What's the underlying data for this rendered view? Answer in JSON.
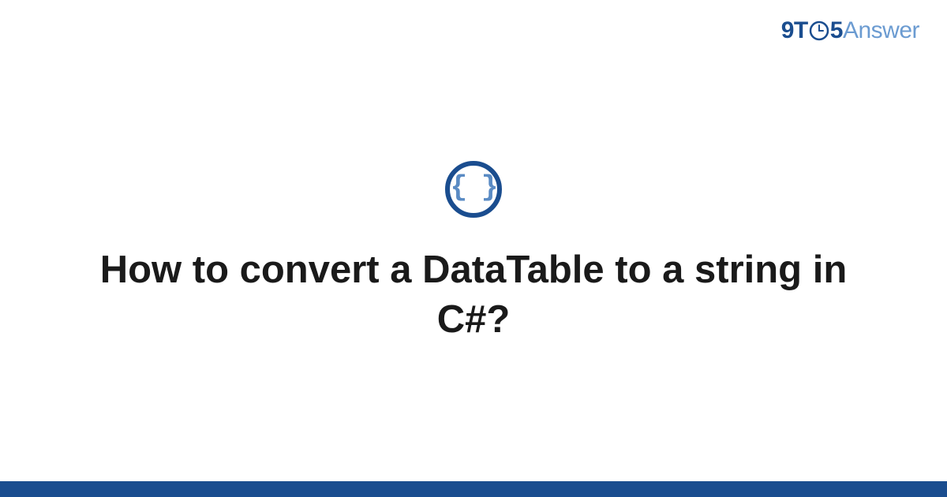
{
  "header": {
    "logo": {
      "part_9t": "9T",
      "part_5": "5",
      "part_answer": "Answer"
    }
  },
  "icon": {
    "name": "code-braces-icon",
    "glyph": "{ }"
  },
  "main": {
    "title": "How to convert a DataTable to a string in C#?"
  },
  "colors": {
    "brand_dark": "#1a4d8f",
    "brand_light": "#6b9bd1",
    "icon_text": "#5a8bc4",
    "footer": "#1a4d8f"
  }
}
